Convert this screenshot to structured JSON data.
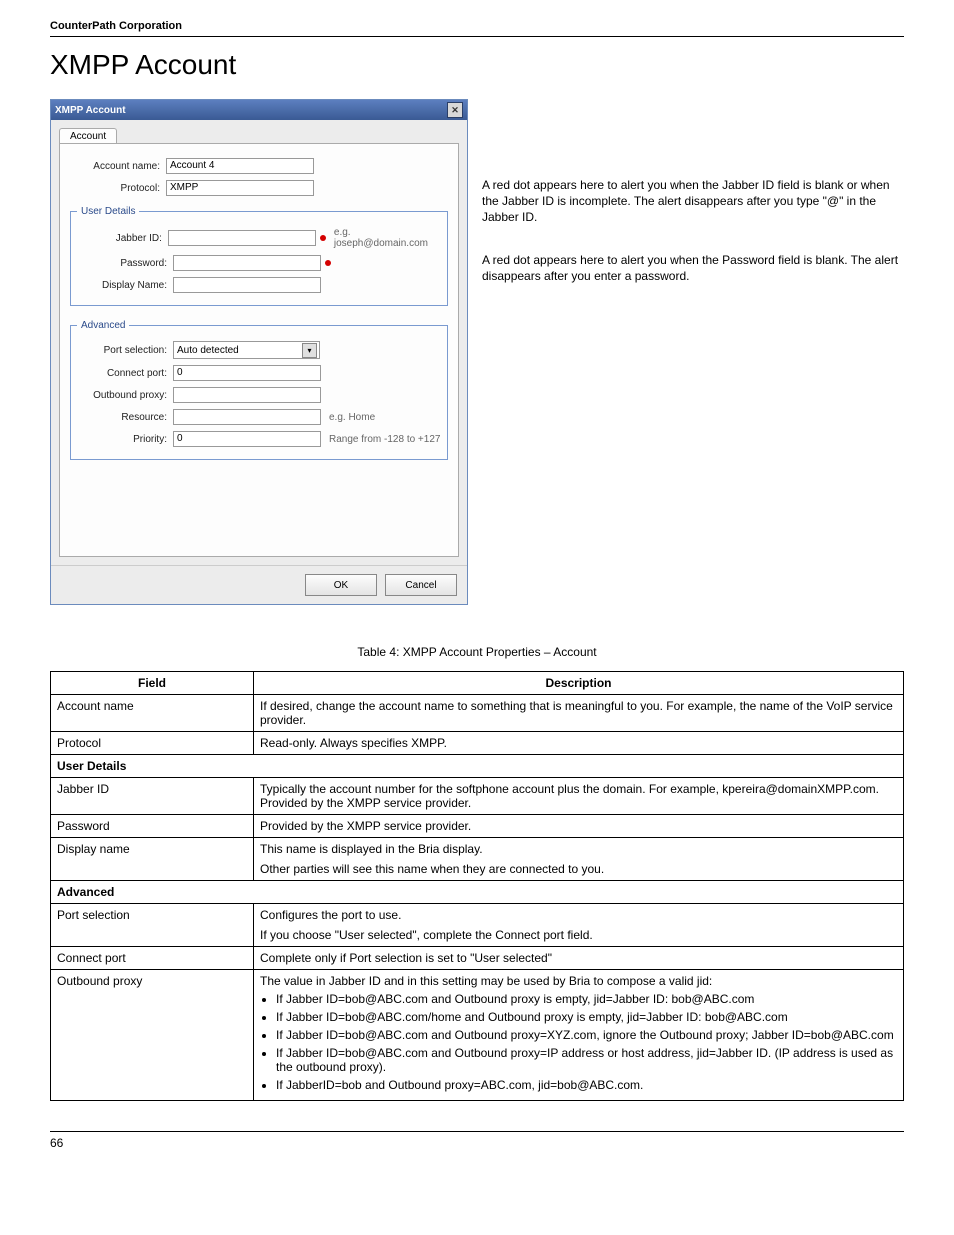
{
  "header": {
    "company": "CounterPath Corporation"
  },
  "title": "XMPP Account",
  "dialog": {
    "window_title": "XMPP Account",
    "tab": "Account",
    "labels": {
      "account_name": "Account name:",
      "protocol": "Protocol:",
      "jabber_id": "Jabber ID:",
      "password": "Password:",
      "display_name": "Display Name:",
      "port_selection": "Port selection:",
      "connect_port": "Connect port:",
      "outbound_proxy": "Outbound proxy:",
      "resource": "Resource:",
      "priority": "Priority:"
    },
    "values": {
      "account_name": "Account 4",
      "protocol": "XMPP",
      "port_selection": "Auto detected",
      "connect_port": "0",
      "priority": "0"
    },
    "legends": {
      "user_details": "User Details",
      "advanced": "Advanced"
    },
    "hints": {
      "jabber_id": "e.g. joseph@domain.com",
      "resource": "e.g. Home",
      "priority": "Range from -128 to +127"
    },
    "buttons": {
      "ok": "OK",
      "cancel": "Cancel"
    }
  },
  "annotations": {
    "jabber": "A red dot appears here to alert you when the Jabber ID field is blank or when the Jabber ID is incomplete. The alert disappears after you type \"@\" in the Jabber ID.",
    "password": "A red dot appears here to alert you when the Password field is blank. The alert disappears after you enter a password."
  },
  "table": {
    "caption": "Table 4: XMPP Account Properties – Account",
    "headers": {
      "field": "Field",
      "description": "Description"
    },
    "rows": {
      "account_name": {
        "field": "Account name",
        "desc": "If desired, change the account name to something that is meaningful to you. For example, the name of the VoIP service provider."
      },
      "protocol": {
        "field": "Protocol",
        "desc": "Read-only. Always specifies XMPP."
      },
      "user_details_section": "User Details",
      "jabber_id": {
        "field": "Jabber ID",
        "desc": "Typically the account number for the softphone account plus the domain. For example, kpereira@domainXMPP.com. Provided by the XMPP service provider."
      },
      "password": {
        "field": "Password",
        "desc": "Provided by the XMPP service provider."
      },
      "display_name": {
        "field": "Display name",
        "desc1": "This name is displayed in the Bria display.",
        "desc2": "Other parties will see this name when they are connected to you."
      },
      "advanced_section": "Advanced",
      "port_selection": {
        "field": "Port selection",
        "desc1": "Configures the port to use.",
        "desc2": "If you choose \"User selected\", complete the Connect port field."
      },
      "connect_port": {
        "field": "Connect port",
        "desc": "Complete only if Port selection is set to \"User selected\""
      },
      "outbound_proxy": {
        "field": "Outbound proxy",
        "intro": "The value in Jabber ID and in this setting may be used by Bria to compose a valid jid:",
        "b1": "If Jabber ID=bob@ABC.com and Outbound proxy is empty, jid=Jabber ID: bob@ABC.com",
        "b2": "If Jabber ID=bob@ABC.com/home and Outbound proxy is empty, jid=Jabber ID: bob@ABC.com",
        "b3": "If Jabber ID=bob@ABC.com and Outbound proxy=XYZ.com, ignore the Outbound proxy; Jabber ID=bob@ABC.com",
        "b4": "If Jabber ID=bob@ABC.com and Outbound proxy=IP address or host address, jid=Jabber ID. (IP address is used as the outbound proxy).",
        "b5": "If JabberID=bob and Outbound proxy=ABC.com, jid=bob@ABC.com."
      }
    }
  },
  "footer": {
    "page": "66"
  }
}
